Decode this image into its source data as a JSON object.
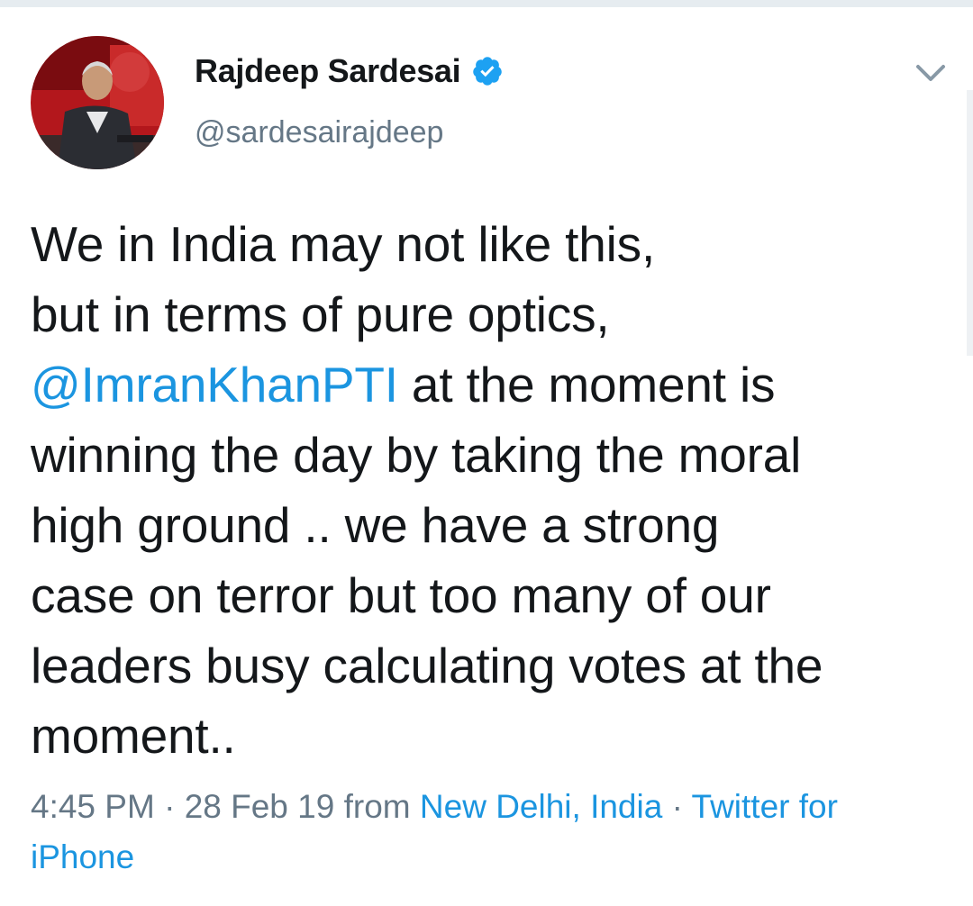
{
  "author": {
    "display_name": "Rajdeep Sardesai",
    "handle": "@sardesairajdeep",
    "verified": true
  },
  "tweet": {
    "lines": [
      "We in India may not like this,",
      "but in terms of pure optics,"
    ],
    "mention": "@ImranKhanPTI",
    "line3_rest": " at the moment is",
    "lines_after": [
      "winning the day by taking the moral",
      "high ground .. we have a strong",
      "case on terror but too many of our",
      "leaders busy calculating votes at the",
      "moment.."
    ]
  },
  "meta": {
    "time": "4:45 PM",
    "separator": " · ",
    "date": "28 Feb 19",
    "from_word": " from ",
    "location": "New Delhi, India",
    "separator2": " · ",
    "source": "Twitter for iPhone"
  },
  "icons": {
    "verified": "verified-badge-icon",
    "caret": "chevron-down-icon"
  },
  "colors": {
    "link": "#1b95e0",
    "muted": "#657786",
    "text": "#14171a",
    "verified": "#1da1f2"
  }
}
